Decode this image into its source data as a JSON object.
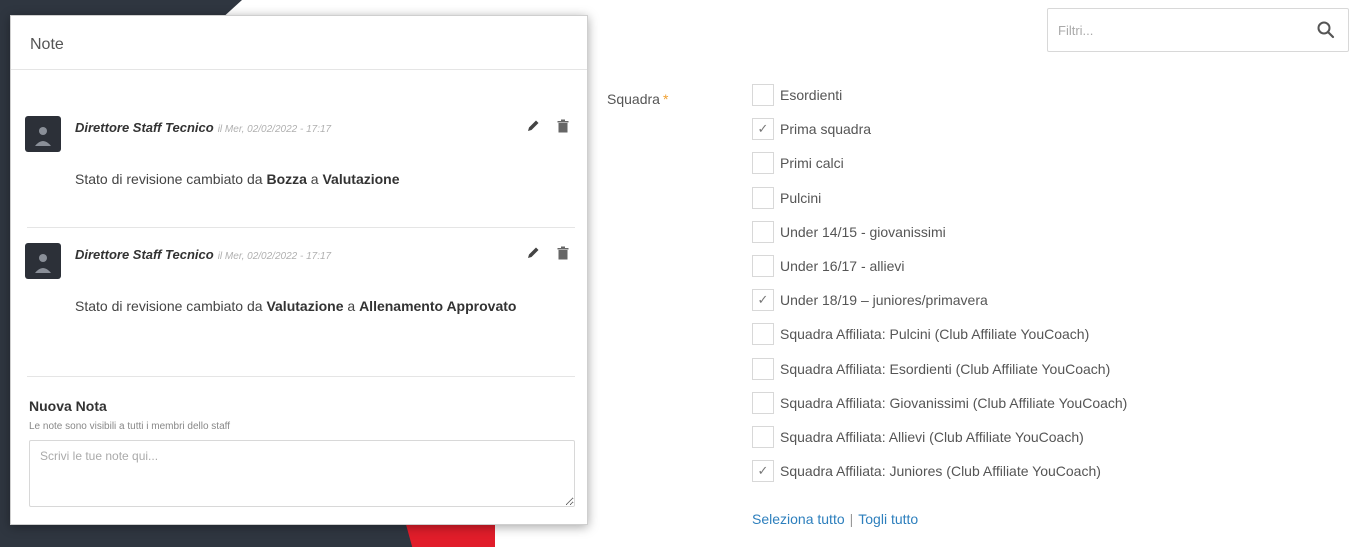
{
  "filter": {
    "placeholder": "Filtri..."
  },
  "team_field": {
    "label": "Squadra",
    "required_marker": "*",
    "options": [
      {
        "label": "Esordienti",
        "checked": false
      },
      {
        "label": "Prima squadra",
        "checked": true
      },
      {
        "label": "Primi calci",
        "checked": false
      },
      {
        "label": "Pulcini",
        "checked": false
      },
      {
        "label": "Under 14/15 - giovanissimi",
        "checked": false
      },
      {
        "label": "Under 16/17 - allievi",
        "checked": false
      },
      {
        "label": "Under 18/19 – juniores/primavera",
        "checked": true
      },
      {
        "label": "Squadra Affiliata: Pulcini (Club Affiliate YouCoach)",
        "checked": false
      },
      {
        "label": "Squadra Affiliata: Esordienti (Club Affiliate YouCoach)",
        "checked": false
      },
      {
        "label": "Squadra Affiliata: Giovanissimi (Club Affiliate YouCoach)",
        "checked": false
      },
      {
        "label": "Squadra Affiliata: Allievi (Club Affiliate YouCoach)",
        "checked": false
      },
      {
        "label": "Squadra Affiliata: Juniores (Club Affiliate YouCoach)",
        "checked": true
      }
    ],
    "select_all": "Seleziona tutto",
    "separator": "|",
    "deselect_all": "Togli tutto"
  },
  "notes": {
    "title": "Note",
    "items": [
      {
        "author": "Direttore Staff Tecnico",
        "date": "il Mer, 02/02/2022 - 17:17",
        "text_prefix": "Stato di revisione cambiato da ",
        "from": "Bozza",
        "connector": " a ",
        "to": "Valutazione"
      },
      {
        "author": "Direttore Staff Tecnico",
        "date": "il Mer, 02/02/2022 - 17:17",
        "text_prefix": "Stato di revisione cambiato da ",
        "from": "Valutazione",
        "connector": " a ",
        "to": "Allenamento Approvato"
      }
    ],
    "new_note_title": "Nuova Nota",
    "new_note_hint": "Le note sono visibili a tutti i membri dello staff",
    "new_note_placeholder": "Scrivi le tue note qui..."
  },
  "colors": {
    "accent_red": "#e11d2a",
    "sidebar_dark": "#2f3640",
    "link_blue": "#2d7fbd",
    "required_orange": "#f0a030"
  }
}
